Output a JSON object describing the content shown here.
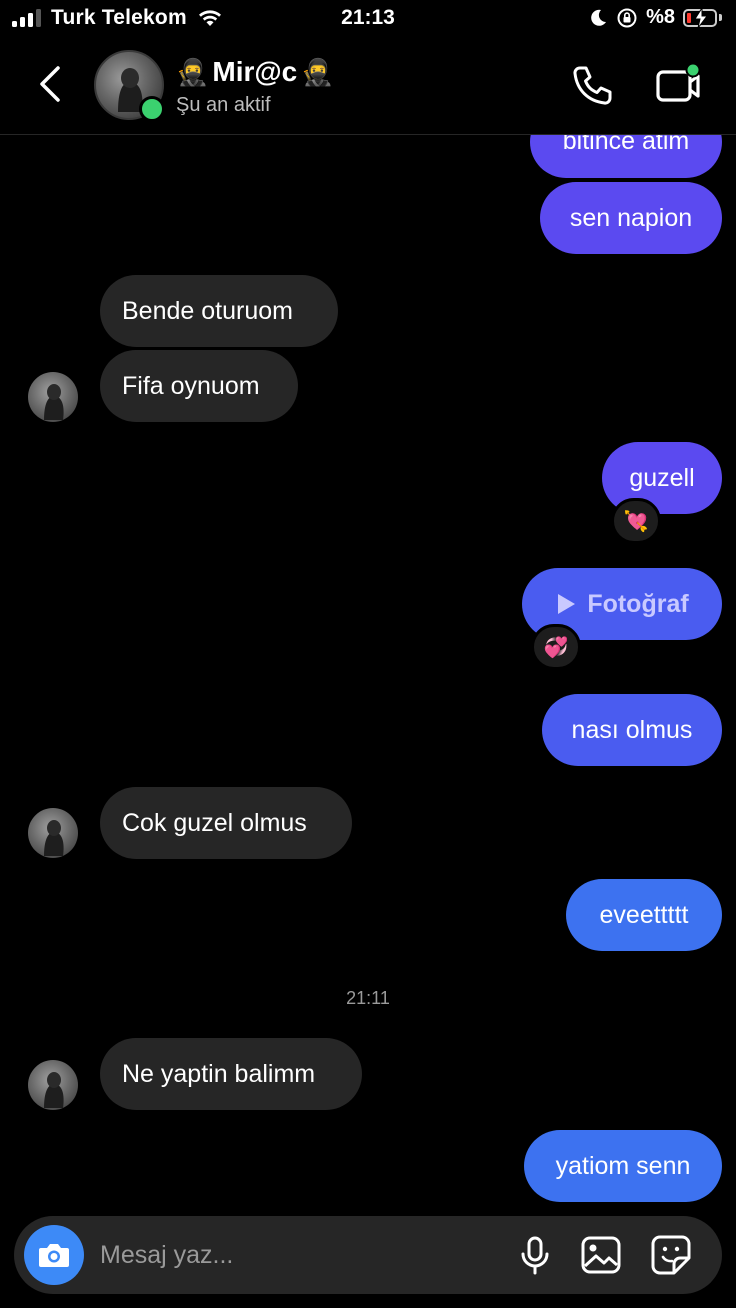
{
  "status_bar": {
    "carrier": "Turk Telekom",
    "time": "21:13",
    "battery": "%8"
  },
  "header": {
    "name": "Mir@c",
    "name_emoji": "🥷",
    "status": "Şu an aktif"
  },
  "messages": [
    {
      "side": "out",
      "text": "bitince atim"
    },
    {
      "side": "out",
      "text": "sen napion"
    },
    {
      "side": "in",
      "text": "Bende oturuom"
    },
    {
      "side": "in",
      "text": "Fifa oynuom"
    },
    {
      "side": "out",
      "text": "guzell",
      "reaction": "💘"
    },
    {
      "side": "out",
      "text": "Fotoğraf",
      "kind": "photo",
      "reaction": "💞"
    },
    {
      "side": "out",
      "text": "nası olmus"
    },
    {
      "side": "in",
      "text": "Cok guzel olmus"
    },
    {
      "side": "out",
      "text": "eveettttt"
    },
    {
      "side": "in",
      "text": "Ne yaptin balimm"
    },
    {
      "side": "out",
      "text": "yatiom senn"
    }
  ],
  "divider_time": "21:11",
  "composer": {
    "placeholder": "Mesaj yaz..."
  },
  "colors": {
    "outgoing_purple": "#5b4af0",
    "outgoing_blue": "#3d72f0",
    "incoming": "#262626",
    "online": "#3bd16f",
    "camera_button": "#3d8af7"
  },
  "icons": [
    "signal-icon",
    "wifi-icon",
    "moon-icon",
    "rotation-lock-icon",
    "battery-icon",
    "back-chevron-icon",
    "phone-icon",
    "video-call-icon",
    "play-icon",
    "camera-icon",
    "microphone-icon",
    "gallery-icon",
    "sticker-icon"
  ]
}
